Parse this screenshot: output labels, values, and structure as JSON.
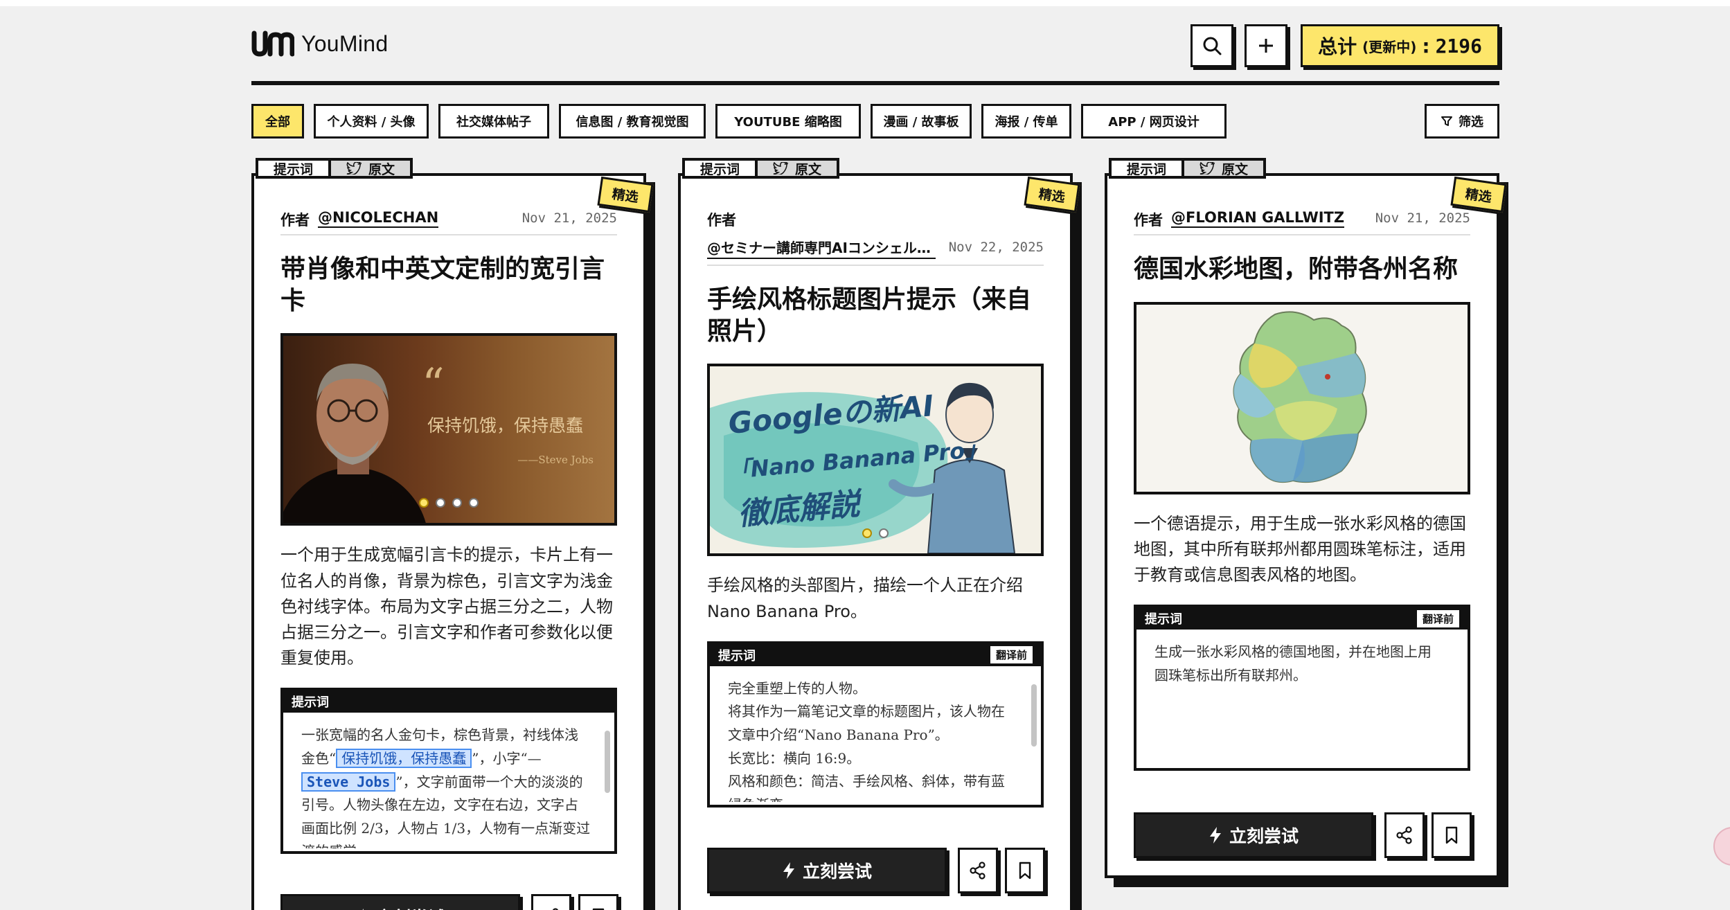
{
  "app": {
    "logo_text": "YouMind"
  },
  "header": {
    "total_label": "总计",
    "total_sub": "(更新中)",
    "total_sep": ":",
    "total_count": "2196"
  },
  "filters": {
    "items": [
      "全部",
      "个人资料 / 头像",
      "社交媒体帖子",
      "信息图 / 教育视觉图",
      "YOUTUBE 缩略图",
      "漫画 / 故事板",
      "海报 / 传单",
      "APP / 网页设计"
    ],
    "active": "全部",
    "filter_label": "筛选"
  },
  "common": {
    "tab_prompt": "提示词",
    "tab_original": "原文",
    "featured": "精选",
    "author_label": "作者",
    "prompt_label": "提示词",
    "translate_label": "翻译前",
    "try_label": "立刻尝试"
  },
  "cards": [
    {
      "author": "@NICOLECHAN",
      "date": "Nov 21, 2025",
      "title": "带肖像和中英文定制的宽引言卡",
      "hero_quote": "保持饥饿，保持愚蠢",
      "hero_sig": "——Steve Jobs",
      "desc": "一个用于生成宽幅引言卡的提示，卡片上有一位名人的肖像，背景为棕色，引言文字为浅金色衬线字体。布局为文字占据三分之二，人物占据三分之一。引言文字和作者可参数化以便重复使用。",
      "prompt_a": "一张宽幅的名人金句卡，棕色背景，衬线体浅金色“",
      "prompt_hl1": "保持饥饿，保持愚蠢",
      "prompt_b": "”，小字“—",
      "prompt_hl2": "Steve Jobs",
      "prompt_c": "”，文字前面带一个大的淡淡的引号。人物头像在左边，文字在右边，文字占画面比例 2/3，人物占 1/3，人物有一点渐变过渡的感觉。",
      "dots": 4
    },
    {
      "author": "@セミナー講師専門AIコンシェルジュ",
      "date": "Nov 22, 2025",
      "title": "手绘风格标题图片提示（来自照片）",
      "hero_line1": "Googleの新AI",
      "hero_line2": "「Nano Banana Pro」",
      "hero_line3": "徹底解説",
      "desc": "手绘风格的头部图片，描绘一个人正在介绍 Nano Banana Pro。",
      "prompt_lines": [
        "完全重塑上传的人物。",
        "将其作为一篇笔记文章的标题图片，该人物在文章中介绍“Nano Banana Pro”。",
        "长宽比：横向 16:9。",
        "风格和颜色：简洁、手绘风格、斜体，带有蓝绿色渐变。"
      ],
      "dots": 2
    },
    {
      "author": "@FLORIAN GALLWITZ",
      "date": "Nov 21, 2025",
      "title": "德国水彩地图，附带各州名称",
      "desc": "一个德语提示，用于生成一张水彩风格的德国地图，其中所有联邦州都用圆珠笔标注，适用于教育或信息图表风格的地图。",
      "prompt_text": "生成一张水彩风格的德国地图，并在地图上用圆珠笔标出所有联邦州。"
    }
  ],
  "colors": {
    "accent": "#fde66b",
    "ink": "#111111",
    "bg": "#f0f0f0"
  }
}
